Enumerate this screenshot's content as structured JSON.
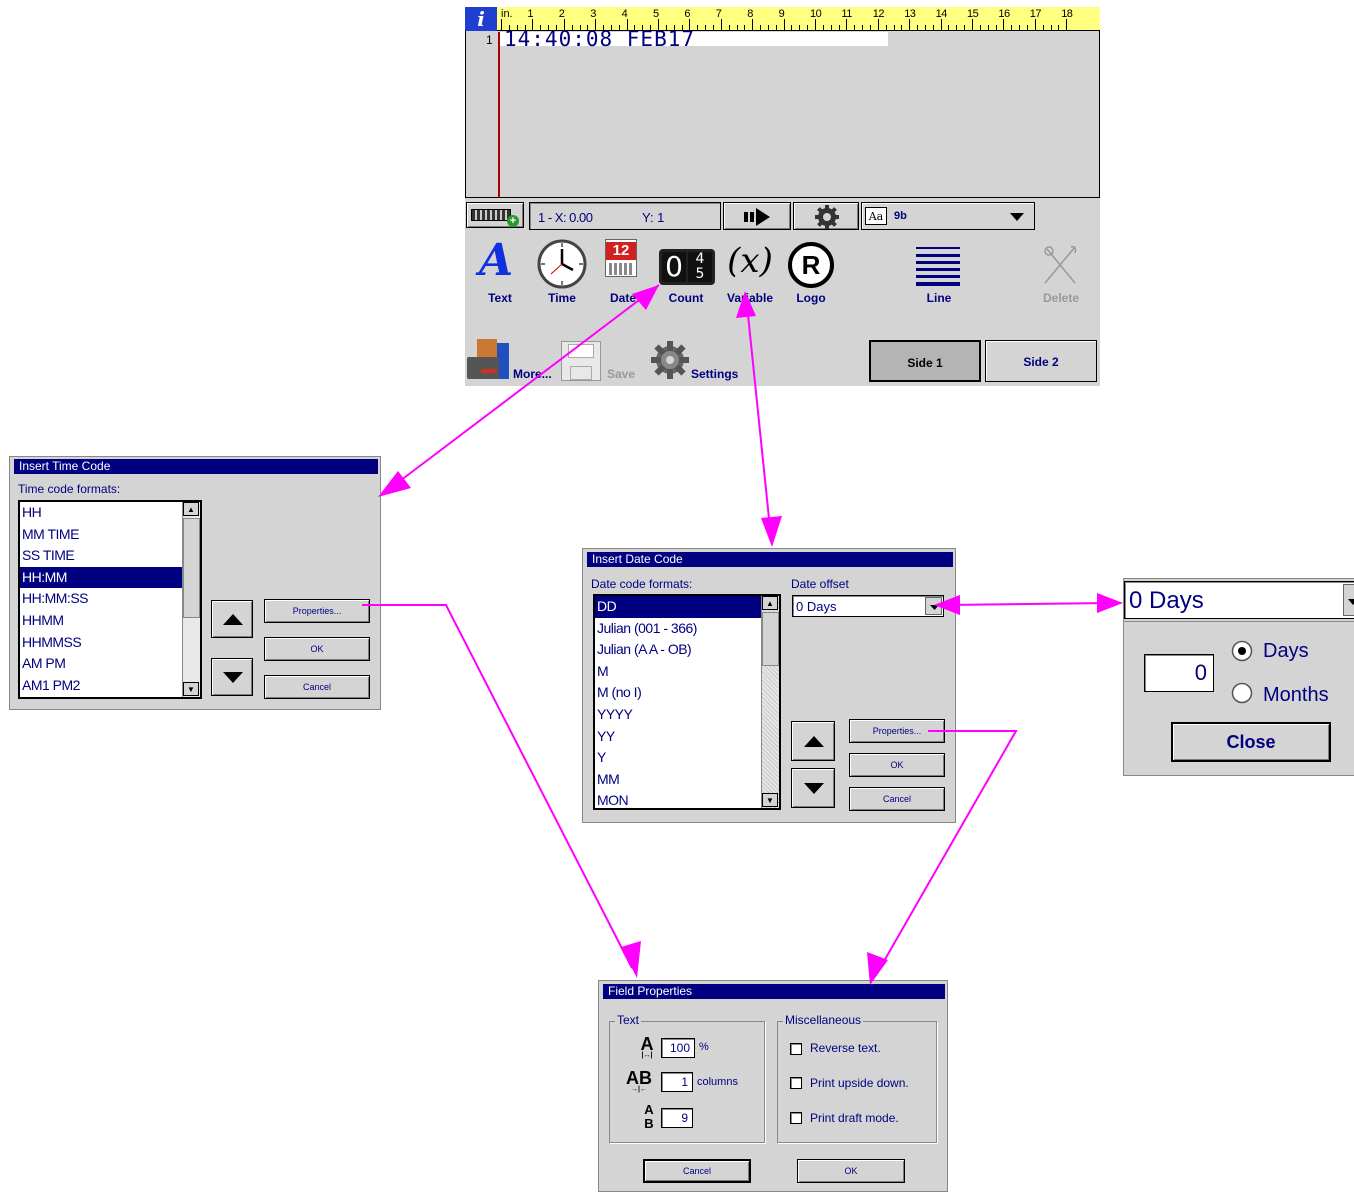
{
  "editor": {
    "ruler_unit": "in.",
    "ruler_ticks": [
      "1",
      "2",
      "3",
      "4",
      "5",
      "6",
      "7",
      "8",
      "9",
      "10",
      "11",
      "12",
      "13",
      "14",
      "15",
      "16",
      "17",
      "18"
    ],
    "line_number": "1",
    "message_text": "14:40:08 FEB17",
    "status_position": "1 - X: 0.00",
    "status_y": "Y: 1",
    "font_icon_text": "Aa",
    "font_name": "9b"
  },
  "toolbar": {
    "text_label": "Text",
    "time_label": "Time",
    "date_label": "Date",
    "date_icon_number": "12",
    "count_label": "Count",
    "variable_label": "Variable",
    "logo_label": "Logo",
    "line_label": "Line",
    "delete_label": "Delete",
    "more_label": "More...",
    "save_label": "Save",
    "settings_label": "Settings",
    "side1_label": "Side 1",
    "side2_label": "Side 2"
  },
  "time_dialog": {
    "title": "Insert Time Code",
    "list_label": "Time code formats:",
    "items": [
      "HH",
      "MM TIME",
      "SS TIME",
      "HH:MM",
      "HH:MM:SS",
      "HHMM",
      "HHMMSS",
      "AM PM",
      "AM1 PM2"
    ],
    "selected_index": 3,
    "properties_label": "Properties...",
    "ok_label": "OK",
    "cancel_label": "Cancel"
  },
  "date_dialog": {
    "title": "Insert Date Code",
    "list_label": "Date code formats:",
    "items": [
      "DD",
      "Julian (001 - 366)",
      "Julian (A A - OB)",
      "M",
      "M (no I)",
      "YYYY",
      "YY",
      "Y",
      "MM",
      "MON"
    ],
    "selected_index": 0,
    "offset_label": "Date offset",
    "offset_value": "0 Days",
    "properties_label": "Properties...",
    "ok_label": "OK",
    "cancel_label": "Cancel"
  },
  "offset_popup": {
    "selected_value": "0 Days",
    "amount_value": "0",
    "days_label": "Days",
    "months_label": "Months",
    "selected_unit": "Days",
    "close_label": "Close"
  },
  "field_properties": {
    "title": "Field Properties",
    "text_group_label": "Text",
    "width_value": "100",
    "width_unit": "%",
    "spacing_value": "1",
    "spacing_unit": "columns",
    "height_value": "9",
    "misc_group_label": "Miscellaneous",
    "reverse_label": "Reverse text.",
    "upside_down_label": "Print upside down.",
    "draft_label": "Print draft mode.",
    "cancel_label": "Cancel",
    "ok_label": "OK"
  },
  "colors": {
    "accent": "#000080",
    "dialog_bg": "#d4d4d4",
    "ruler": "#ffff80",
    "connector": "#ff00ff",
    "cursor": "#b00000"
  }
}
